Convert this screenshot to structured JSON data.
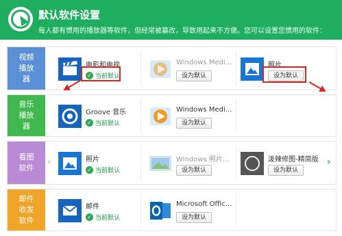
{
  "header": {
    "title": "默认软件设置",
    "subtitle": "每人都有惯用的播放器等软件，但经常被篡改，导致用起来不方便。您可以设置您惯用的软件："
  },
  "colors": {
    "header": "#1fae5f",
    "video": "#5b8fd6",
    "music": "#3fb84e",
    "image": "#b98ad6",
    "mail": "#f0a428",
    "annotation": "#e0201f"
  },
  "rows": [
    {
      "category": "视频播放器",
      "apps": [
        {
          "name": "电影和电视",
          "icon": "film-clapper-icon",
          "status": "当前默认"
        },
        {
          "name": "Windows Medi...",
          "icon": "windows-media-player-icon",
          "button": "设为默认"
        },
        {
          "name": "照片",
          "icon": "photos-icon",
          "button": "设为默认"
        }
      ]
    },
    {
      "category": "音乐播放器",
      "apps": [
        {
          "name": "Groove 音乐",
          "icon": "groove-music-icon",
          "status": "当前默认"
        },
        {
          "name": "Windows Medi...",
          "icon": "windows-media-player-icon",
          "button": "设为默认"
        }
      ]
    },
    {
      "category": "看图软件",
      "apps": [
        {
          "name": "照片",
          "icon": "photos-icon",
          "status": "当前默认"
        },
        {
          "name": "Windows 照片...",
          "icon": "windows-photo-viewer-icon",
          "button": "设为默认"
        },
        {
          "name": "泼辣修图-精简版",
          "icon": "polarr-icon",
          "button": "设为默认"
        }
      ]
    },
    {
      "category": "邮件收发软件",
      "apps": [
        {
          "name": "邮件",
          "icon": "mail-icon",
          "status": "当前默认"
        },
        {
          "name": "Microsoft Offic...",
          "icon": "outlook-icon",
          "button": "设为默认"
        }
      ]
    }
  ]
}
